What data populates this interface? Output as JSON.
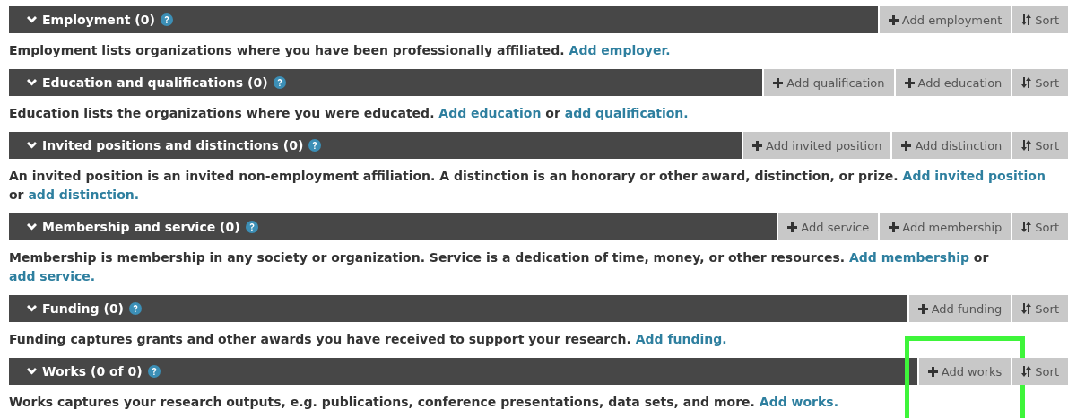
{
  "sections": [
    {
      "title": "Employment (0)",
      "buttons": [
        {
          "kind": "add",
          "label": "Add employment",
          "highlighted": false
        },
        {
          "kind": "sort",
          "label": "Sort",
          "highlighted": false
        }
      ],
      "description": [
        {
          "kind": "text",
          "text": "Employment lists organizations where you have been professionally affiliated. "
        },
        {
          "kind": "link",
          "text": "Add employer."
        }
      ]
    },
    {
      "title": "Education and qualifications (0)",
      "buttons": [
        {
          "kind": "add",
          "label": "Add qualification",
          "highlighted": false
        },
        {
          "kind": "add",
          "label": "Add education",
          "highlighted": false
        },
        {
          "kind": "sort",
          "label": "Sort",
          "highlighted": false
        }
      ],
      "description": [
        {
          "kind": "text",
          "text": "Education lists the organizations where you were educated. "
        },
        {
          "kind": "link",
          "text": "Add education"
        },
        {
          "kind": "text",
          "text": " or "
        },
        {
          "kind": "link",
          "text": "add qualification."
        }
      ]
    },
    {
      "title": "Invited positions and distinctions (0)",
      "buttons": [
        {
          "kind": "add",
          "label": "Add invited position",
          "highlighted": false
        },
        {
          "kind": "add",
          "label": "Add distinction",
          "highlighted": false
        },
        {
          "kind": "sort",
          "label": "Sort",
          "highlighted": false
        }
      ],
      "description": [
        {
          "kind": "text",
          "text": "An invited position is an invited non-employment affiliation. A distinction is an honorary or other award, distinction, or prize. "
        },
        {
          "kind": "link",
          "text": "Add invited position"
        },
        {
          "kind": "text",
          "text": " or "
        },
        {
          "kind": "link",
          "text": "add distinction."
        }
      ]
    },
    {
      "title": "Membership and service (0)",
      "buttons": [
        {
          "kind": "add",
          "label": "Add service",
          "highlighted": false
        },
        {
          "kind": "add",
          "label": "Add membership",
          "highlighted": false
        },
        {
          "kind": "sort",
          "label": "Sort",
          "highlighted": false
        }
      ],
      "description": [
        {
          "kind": "text",
          "text": "Membership is membership in any society or organization. Service is a dedication of time, money, or other resources. "
        },
        {
          "kind": "link",
          "text": "Add membership"
        },
        {
          "kind": "text",
          "text": " or "
        },
        {
          "kind": "link",
          "text": "add service."
        }
      ]
    },
    {
      "title": "Funding (0)",
      "buttons": [
        {
          "kind": "add",
          "label": "Add funding",
          "highlighted": false
        },
        {
          "kind": "sort",
          "label": "Sort",
          "highlighted": false
        }
      ],
      "description": [
        {
          "kind": "text",
          "text": "Funding captures grants and other awards you have received to support your research. "
        },
        {
          "kind": "link",
          "text": "Add funding."
        }
      ]
    },
    {
      "title": "Works (0 of 0)",
      "buttons": [
        {
          "kind": "add",
          "label": "Add works",
          "highlighted": true
        },
        {
          "kind": "sort",
          "label": "Sort",
          "highlighted": false
        }
      ],
      "description": [
        {
          "kind": "text",
          "text": "Works captures your research outputs, e.g. publications, conference presentations, data sets, and more. "
        },
        {
          "kind": "link",
          "text": "Add works."
        }
      ]
    }
  ]
}
